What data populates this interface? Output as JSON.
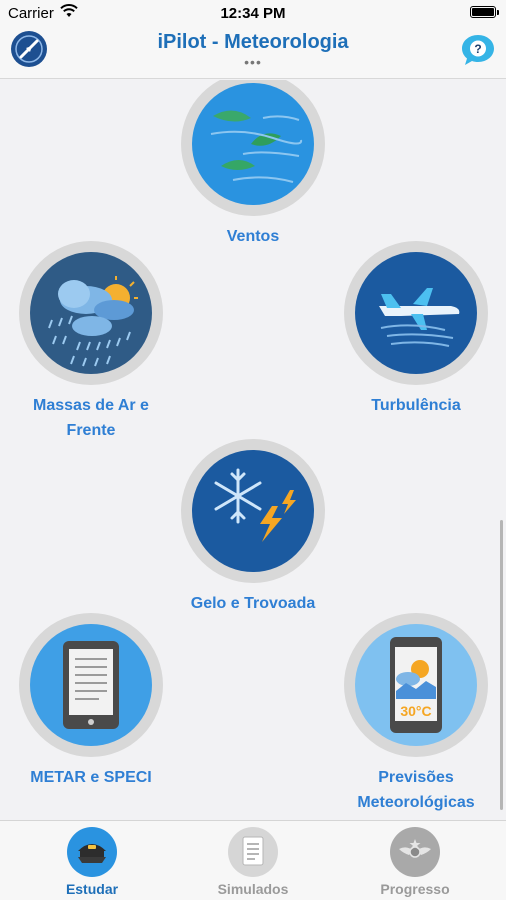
{
  "status_bar": {
    "carrier": "Carrier",
    "time": "12:34 PM"
  },
  "nav": {
    "title": "iPilot - Meteorologia",
    "dots": "•••"
  },
  "topics": [
    {
      "label": "Ventos"
    },
    {
      "label": "Massas de Ar e Frente"
    },
    {
      "label": "Turbulência"
    },
    {
      "label": "Gelo e Trovoada"
    },
    {
      "label": "METAR e SPECI"
    },
    {
      "label": "Previsões Meteorológicas",
      "display": "30°C"
    }
  ],
  "tabs": [
    {
      "label": "Estudar"
    },
    {
      "label": "Simulados"
    },
    {
      "label": "Progresso"
    }
  ],
  "colors": {
    "accent": "#1e6fb8",
    "circle_blue": "#2a93e0",
    "circle_dark": "#1b5aa0",
    "ring": "#d8d8d8"
  }
}
